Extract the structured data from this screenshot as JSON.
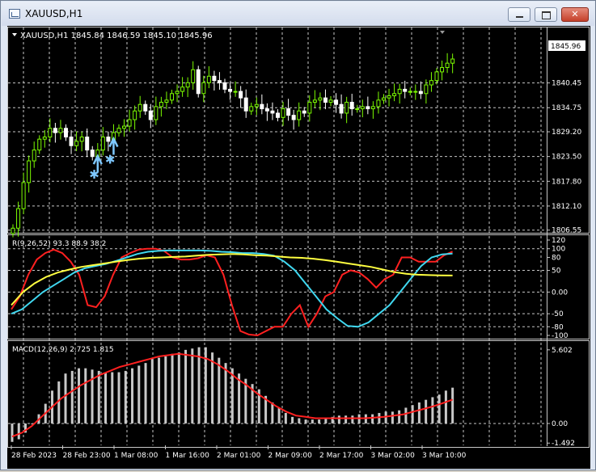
{
  "window": {
    "title": "XAUUSD,H1"
  },
  "colors": {
    "background": "#000000",
    "grid": "#c8c8c8",
    "bull_candle": "#7cfc00",
    "bear_candle": "#ffffff",
    "signal": "#7ec8ff",
    "rsi_red": "#ff2020",
    "rsi_cyan": "#40d8f0",
    "rsi_yellow": "#ffff40",
    "macd_hist": "#c8c8c8",
    "macd_signal": "#ff2020"
  },
  "chart_data": [
    {
      "type": "candlestick",
      "label": "XAUUSD,H1 1845.84 1846.59 1845.10 1845.96",
      "current_price": "1845.96",
      "ylim": [
        1806.5,
        1849.5
      ],
      "yticks": [
        "1840.45",
        "1834.75",
        "1829.20",
        "1823.50",
        "1817.80",
        "1812.10",
        "1806.55"
      ],
      "ytick_values": [
        1840.45,
        1834.75,
        1829.2,
        1823.5,
        1817.8,
        1812.1,
        1806.55
      ],
      "close": [
        1807,
        1811.5,
        1817.5,
        1822.5,
        1825,
        1827.5,
        1828,
        1830,
        1829,
        1830,
        1828,
        1826,
        1827,
        1828,
        1825,
        1823.5,
        1825,
        1828,
        1827,
        1829,
        1830,
        1830.5,
        1832,
        1834,
        1835.5,
        1834,
        1832,
        1835,
        1836,
        1836.5,
        1838,
        1838.5,
        1839.5,
        1840.5,
        1843.5,
        1838,
        1840.5,
        1842,
        1841,
        1840.5,
        1839,
        1838.5,
        1838.5,
        1837,
        1834,
        1835,
        1835.5,
        1834.5,
        1834,
        1833.5,
        1832.5,
        1834.5,
        1833,
        1832,
        1834,
        1833.5,
        1836,
        1836.5,
        1837,
        1836,
        1836.5,
        1835.5,
        1833.5,
        1836,
        1834.5,
        1834.5,
        1835,
        1834.5,
        1835,
        1836.5,
        1837,
        1837.5,
        1838,
        1839,
        1838.5,
        1838.5,
        1838.5,
        1838,
        1840,
        1841,
        1843,
        1844,
        1845,
        1845.96
      ],
      "signal_markers": [
        {
          "index": 15,
          "symbol": "*",
          "position": "below"
        },
        {
          "index": 16,
          "symbol": "arrow-up",
          "position": "below"
        },
        {
          "index": 18,
          "symbol": "*",
          "position": "below"
        },
        {
          "index": 19,
          "symbol": "arrow-up",
          "position": "below"
        }
      ]
    },
    {
      "type": "line",
      "label": "R(9,26,52) 93.3 88.9 38.2",
      "ylim": [
        -100,
        120
      ],
      "yticks": [
        "120",
        "100",
        "80",
        "50",
        "0.00",
        "-50",
        "-80",
        "-100"
      ],
      "ytick_values": [
        120,
        100,
        80,
        50,
        0,
        -50,
        -80,
        -100
      ],
      "series": [
        {
          "color": "#ff2020",
          "values": [
            -40,
            -10,
            40,
            75,
            90,
            98,
            90,
            70,
            40,
            -30,
            -35,
            -10,
            40,
            80,
            90,
            98,
            100,
            100,
            95,
            80,
            75,
            75,
            78,
            85,
            80,
            40,
            -30,
            -90,
            -98,
            -100,
            -90,
            -80,
            -80,
            -50,
            -30,
            -80,
            -50,
            -10,
            0,
            40,
            50,
            45,
            30,
            10,
            30,
            40,
            80,
            80,
            70,
            70,
            70,
            85,
            93.3
          ]
        },
        {
          "color": "#40d8f0",
          "values": [
            -50,
            -40,
            -20,
            0,
            15,
            30,
            45,
            55,
            60,
            65,
            72,
            80,
            88,
            93,
            95,
            96,
            96,
            96,
            96,
            95,
            93,
            92,
            90,
            90,
            88,
            84,
            70,
            50,
            20,
            -10,
            -40,
            -60,
            -78,
            -80,
            -70,
            -50,
            -30,
            0,
            30,
            60,
            80,
            87,
            88.9
          ]
        },
        {
          "color": "#ffff40",
          "values": [
            -30,
            0,
            20,
            35,
            45,
            52,
            58,
            62,
            66,
            70,
            74,
            77,
            79,
            80,
            81,
            82,
            84,
            86,
            87,
            88,
            87,
            85,
            84,
            82,
            80,
            79,
            77,
            74,
            70,
            66,
            62,
            58,
            52,
            46,
            42,
            40,
            39,
            38.5,
            38.2
          ]
        }
      ]
    },
    {
      "type": "bar",
      "label": "MACD(12,26,9) 2.725 1.815",
      "ylim": [
        -1.6,
        5.9
      ],
      "yticks": [
        "5.602",
        "0.00",
        "-1.492"
      ],
      "ytick_values": [
        5.602,
        0,
        -1.492
      ],
      "series": [
        {
          "name": "MACD",
          "values": [
            -1.4,
            -1.2,
            -0.7,
            0,
            0.7,
            1.5,
            2.5,
            3.2,
            3.8,
            4.0,
            4.2,
            4.2,
            4.1,
            4.0,
            3.9,
            3.9,
            3.9,
            4.0,
            4.2,
            4.4,
            4.6,
            4.9,
            5.0,
            5.1,
            5.3,
            5.4,
            5.6,
            5.7,
            5.8,
            5.8,
            5.4,
            5.0,
            4.6,
            4.2,
            3.8,
            3.4,
            3.0,
            2.6,
            2.1,
            1.6,
            1.2,
            0.8,
            0.5,
            0.4,
            0.3,
            0.3,
            0.3,
            0.4,
            0.5,
            0.6,
            0.6,
            0.6,
            0.7,
            0.7,
            0.7,
            0.8,
            0.9,
            0.9,
            1.0,
            1.2,
            1.4,
            1.6,
            1.8,
            2.0,
            2.2,
            2.5,
            2.725
          ]
        },
        {
          "name": "Signal",
          "values": [
            -1.0,
            -0.7,
            -0.2,
            0.5,
            1.2,
            1.9,
            2.4,
            2.9,
            3.3,
            3.7,
            4.0,
            4.3,
            4.5,
            4.7,
            4.9,
            5.1,
            5.2,
            5.3,
            5.2,
            5.1,
            4.9,
            4.5,
            4.0,
            3.4,
            2.9,
            2.3,
            1.8,
            1.3,
            0.9,
            0.6,
            0.5,
            0.4,
            0.4,
            0.4,
            0.4,
            0.4,
            0.4,
            0.45,
            0.5,
            0.6,
            0.7,
            0.9,
            1.1,
            1.3,
            1.55,
            1.815
          ]
        }
      ]
    }
  ],
  "time_axis": {
    "labels": [
      "28 Feb 2023",
      "28 Feb 23:00",
      "1 Mar 08:00",
      "1 Mar 16:00",
      "2 Mar 01:00",
      "2 Mar 09:00",
      "2 Mar 17:00",
      "3 Mar 02:00",
      "3 Mar 10:00"
    ]
  }
}
